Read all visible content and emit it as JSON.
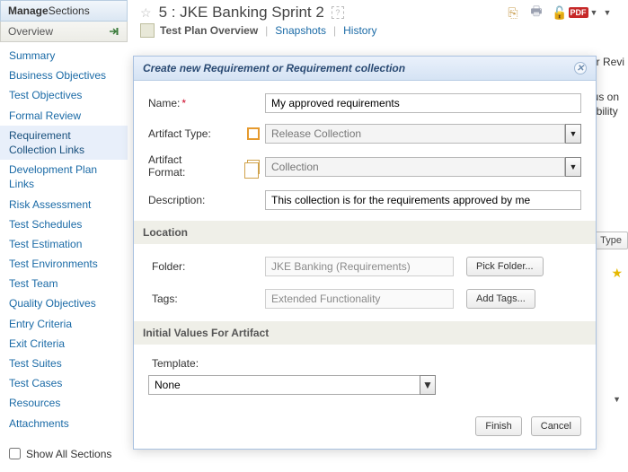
{
  "sidebar": {
    "header_bold": "Manage",
    "header_rest": " Sections",
    "subheader": "Overview",
    "items": [
      {
        "label": "Summary"
      },
      {
        "label": "Business Objectives"
      },
      {
        "label": "Test Objectives"
      },
      {
        "label": "Formal Review"
      },
      {
        "label": "Requirement Collection Links"
      },
      {
        "label": "Development Plan Links"
      },
      {
        "label": "Risk Assessment"
      },
      {
        "label": "Test Schedules"
      },
      {
        "label": "Test Estimation"
      },
      {
        "label": "Test Environments"
      },
      {
        "label": "Test Team"
      },
      {
        "label": "Quality Objectives"
      },
      {
        "label": "Entry Criteria"
      },
      {
        "label": "Exit Criteria"
      },
      {
        "label": "Test Suites"
      },
      {
        "label": "Test Cases"
      },
      {
        "label": "Resources"
      },
      {
        "label": "Attachments"
      }
    ],
    "active_index": 4,
    "show_all_label": "Show All Sections"
  },
  "header": {
    "favorite_icon": "star-outline-icon",
    "title": "5 :   JKE Banking Sprint 2",
    "help": "?",
    "toolbar": {
      "copy": "copy-icon",
      "print": "print-icon",
      "unlock": "unlock-icon",
      "pdf": "PDF",
      "menu": "menu-icon"
    },
    "subnav": {
      "overview": "Test Plan Overview",
      "snapshots": "Snapshots",
      "history": "History"
    }
  },
  "background_fragments": {
    "under_review": "er Revi",
    "para_line1": "ocus on",
    "para_line2": "e ability",
    "type_button": "Type",
    "star": "★"
  },
  "dialog": {
    "title": "Create new Requirement or Requirement collection",
    "labels": {
      "name": "Name:",
      "artifact_type": "Artifact Type:",
      "artifact_format": "Artifact Format:",
      "description": "Description:",
      "folder": "Folder:",
      "tags": "Tags:",
      "template": "Template:"
    },
    "values": {
      "name": "My approved requirements",
      "artifact_type": "Release Collection",
      "artifact_format": "Collection",
      "description": "This collection is for the requirements approved by me",
      "folder": "JKE Banking (Requirements)",
      "tags": "Extended Functionality",
      "template": "None"
    },
    "sections": {
      "location": "Location",
      "initial_values": "Initial Values For Artifact"
    },
    "buttons": {
      "pick_folder": "Pick Folder...",
      "add_tags": "Add Tags...",
      "finish": "Finish",
      "cancel": "Cancel"
    }
  }
}
